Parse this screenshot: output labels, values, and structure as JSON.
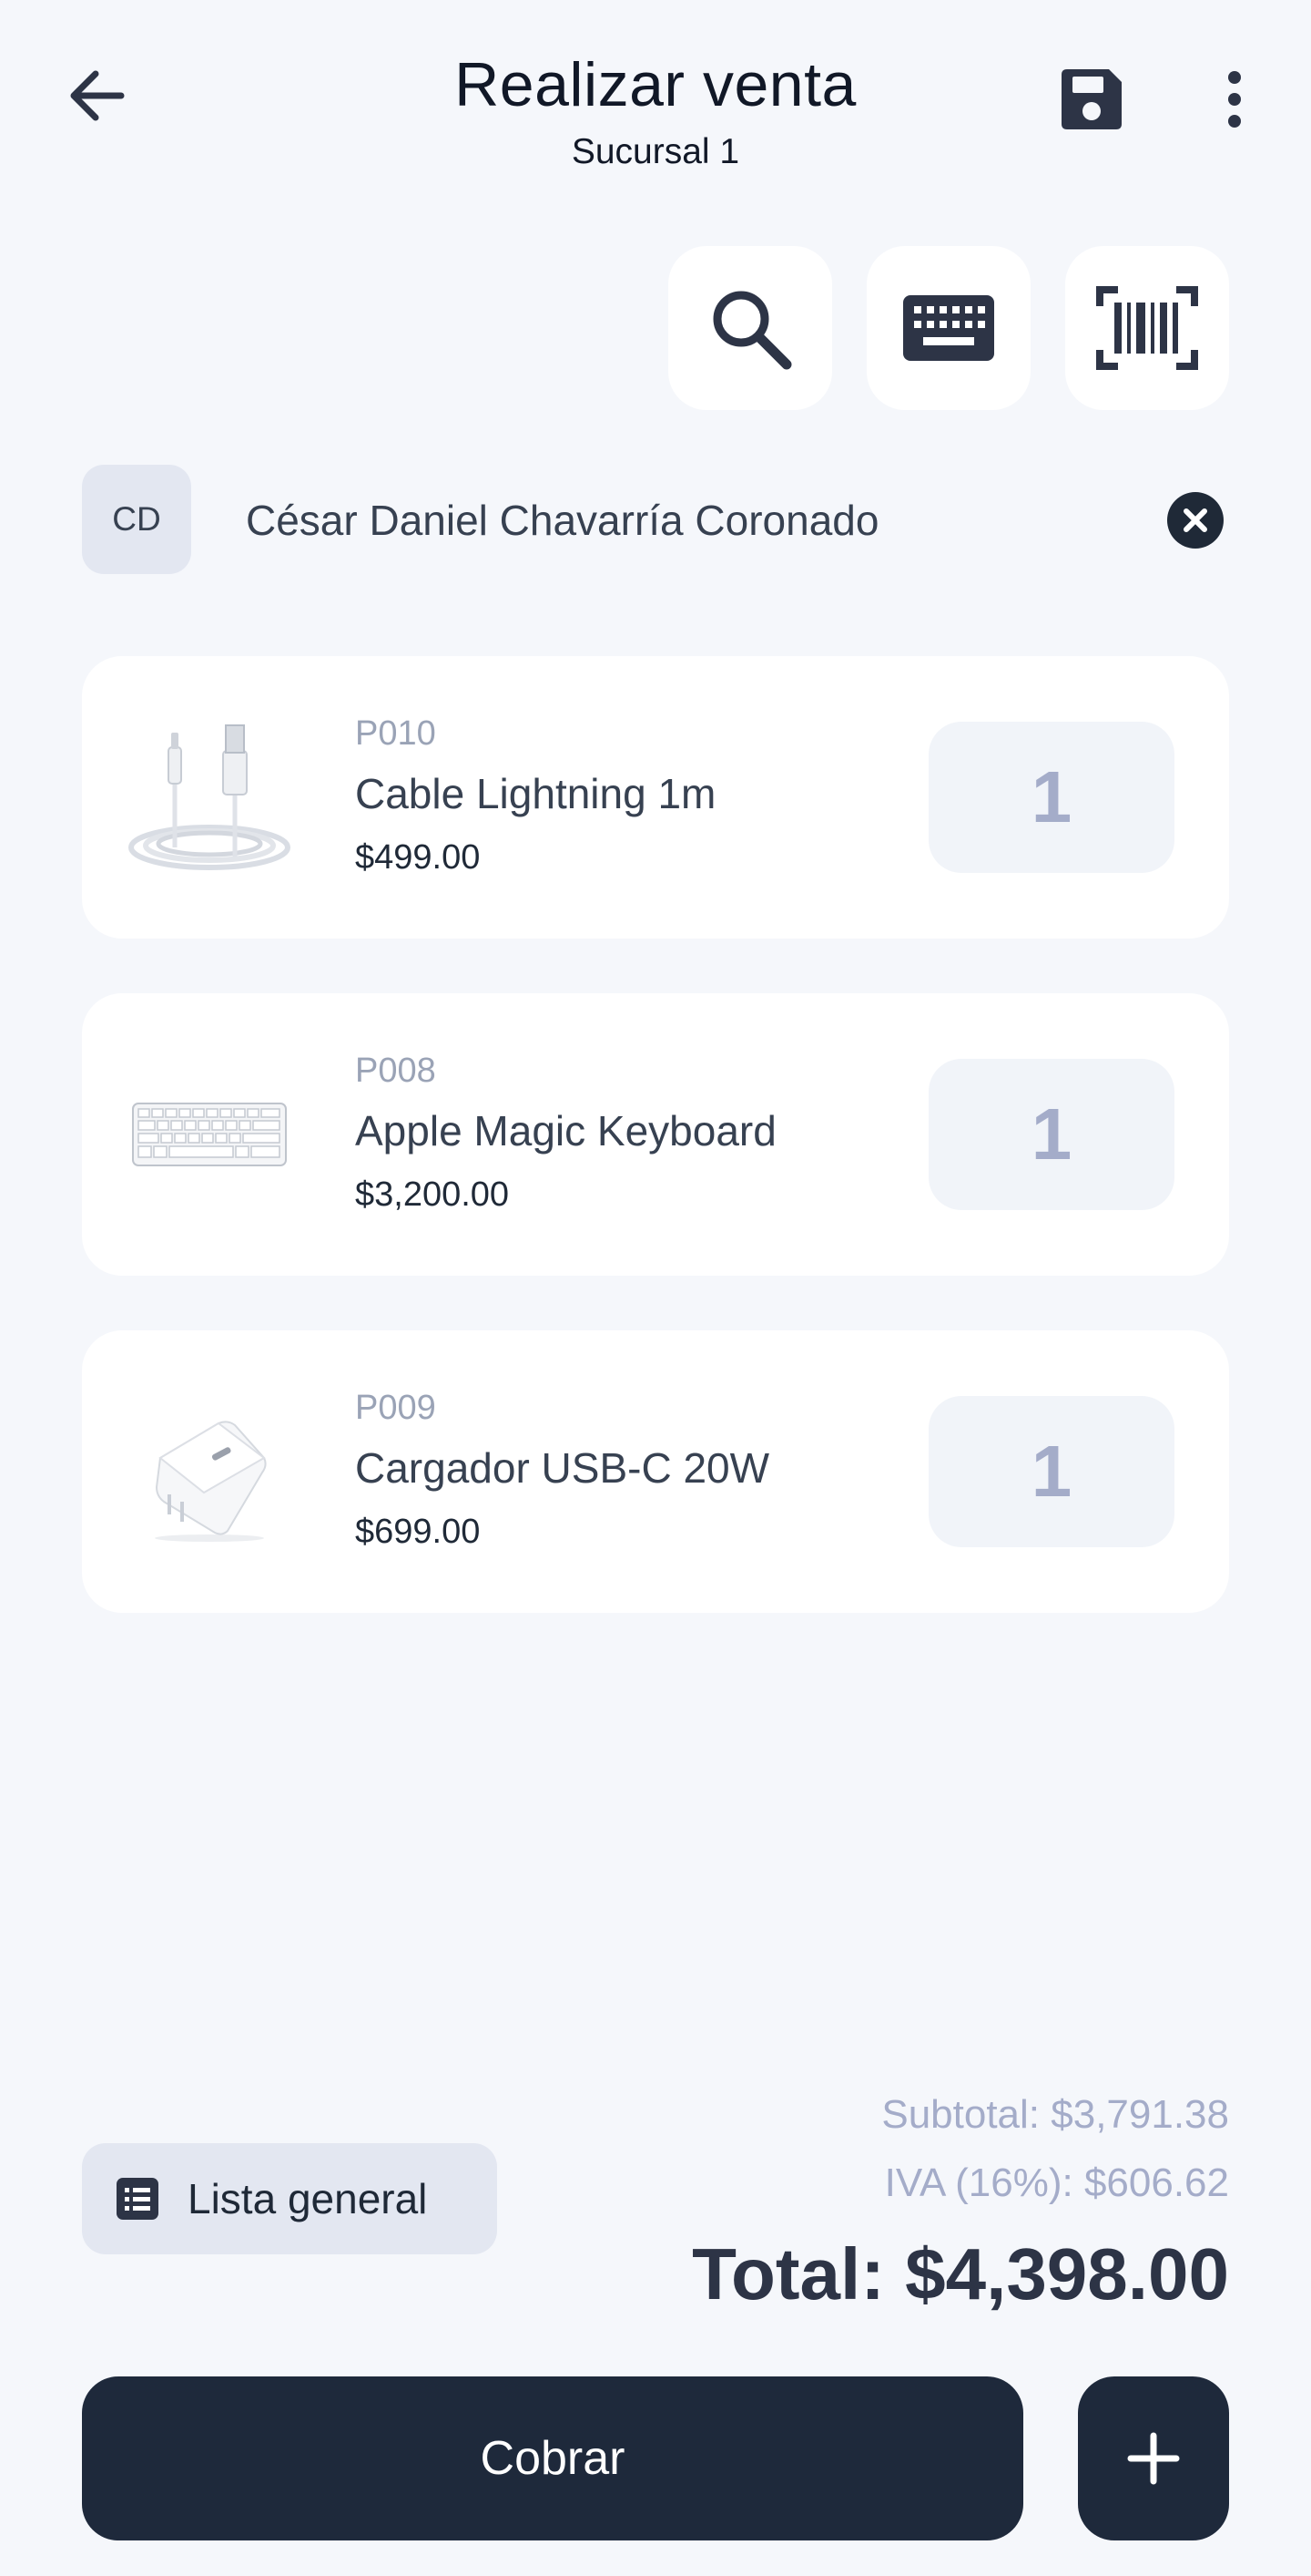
{
  "header": {
    "title": "Realizar venta",
    "subtitle": "Sucursal 1",
    "back_icon": "arrow-left-icon",
    "save_icon": "floppy-disk-icon",
    "more_icon": "more-vertical-icon"
  },
  "tools": [
    {
      "icon": "search-icon"
    },
    {
      "icon": "keyboard-icon"
    },
    {
      "icon": "barcode-scanner-icon"
    }
  ],
  "customer": {
    "initials": "CD",
    "name": "César Daniel Chavarría Coronado",
    "clear_icon": "close-circle-icon"
  },
  "products": [
    {
      "code": "P010",
      "name": "Cable Lightning 1m",
      "price": "$499.00",
      "qty": "1",
      "image": "lightning-cable-image"
    },
    {
      "code": "P008",
      "name": "Apple Magic Keyboard",
      "price": "$3,200.00",
      "qty": "1",
      "image": "magic-keyboard-image"
    },
    {
      "code": "P009",
      "name": "Cargador USB-C 20W",
      "price": "$699.00",
      "qty": "1",
      "image": "usbc-charger-image"
    }
  ],
  "footer": {
    "list_label": "Lista general",
    "list_icon": "list-icon",
    "subtotal": "Subtotal: $3,791.38",
    "iva": "IVA (16%): $606.62",
    "total": "Total: $4,398.00",
    "charge_label": "Cobrar",
    "add_icon": "plus-icon"
  },
  "colors": {
    "background": "#f5f7fb",
    "primary_dark": "#1e293b",
    "muted_text": "#a4acc9",
    "card": "#ffffff"
  }
}
